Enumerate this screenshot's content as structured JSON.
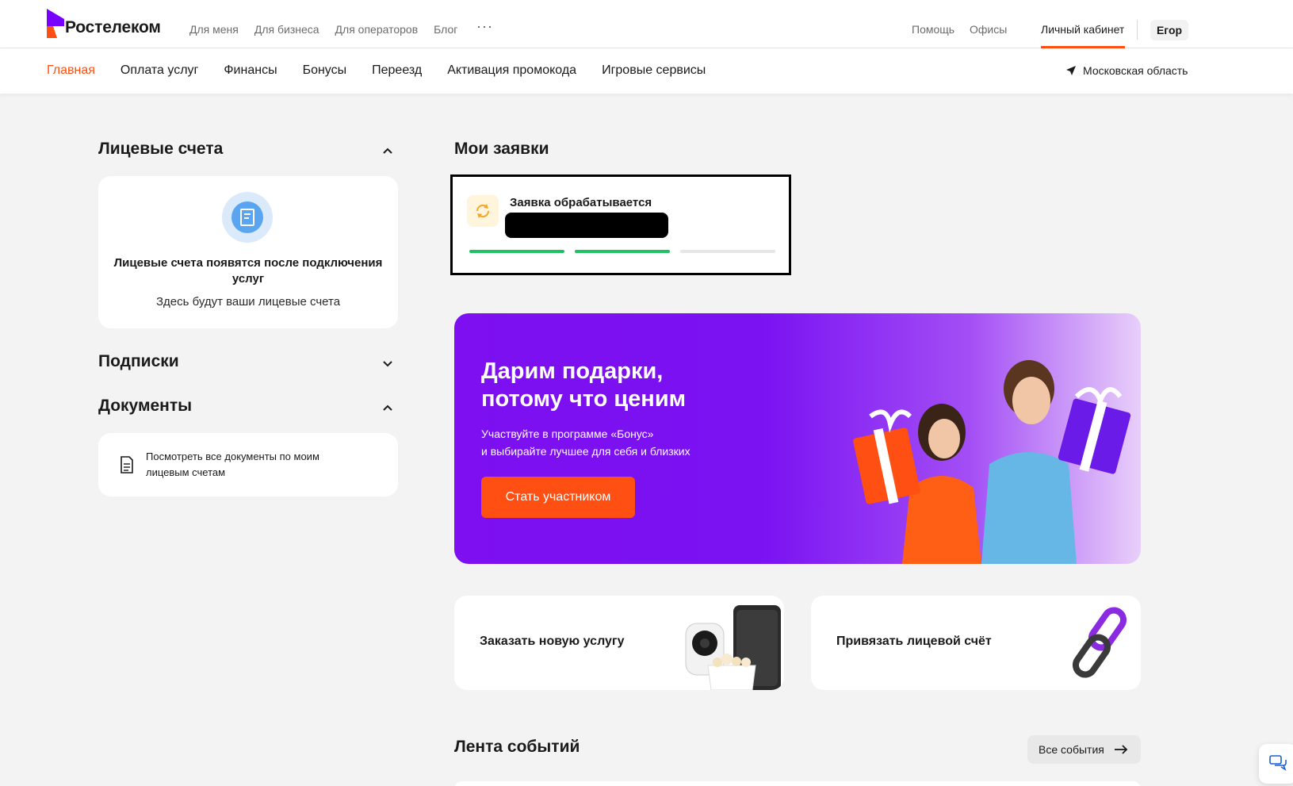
{
  "header": {
    "brand": "Ростелеком",
    "nav": [
      "Для меня",
      "Для бизнеса",
      "Для операторов",
      "Блог"
    ],
    "more": "···",
    "help": "Помощь",
    "offices": "Офисы",
    "cabinet": "Личный кабинет",
    "user": "Егор"
  },
  "subnav": {
    "items": [
      "Главная",
      "Оплата услуг",
      "Финансы",
      "Бонусы",
      "Переезд",
      "Активация промокода",
      "Игровые сервисы"
    ],
    "region": "Московская область"
  },
  "left": {
    "accounts_title": "Лицевые счета",
    "accounts_empty_title": "Лицевые счета появятся после подключения услуг",
    "accounts_empty_sub": "Здесь будут ваши лицевые счета",
    "subscriptions_title": "Подписки",
    "documents_title": "Документы",
    "documents_link": "Посмотреть все документы по моим лицевым счетам"
  },
  "requests": {
    "title": "Мои заявки",
    "status": "Заявка обрабатывается",
    "progress_done": 2,
    "progress_total": 3
  },
  "banner": {
    "title_line1": "Дарим подарки,",
    "title_line2": "потому что ценим",
    "sub_line1": "Участвуйте в программе «Бонус»",
    "sub_line2": "и выбирайте лучшее для себя и близких",
    "button": "Стать участником"
  },
  "tiles": {
    "order": "Заказать новую услугу",
    "link": "Привязать лицевой счёт"
  },
  "feed": {
    "title": "Лента событий",
    "all": "Все события"
  },
  "colors": {
    "accent": "#ff4f12",
    "brand_purple": "#7700ff",
    "progress": "#20c162"
  }
}
